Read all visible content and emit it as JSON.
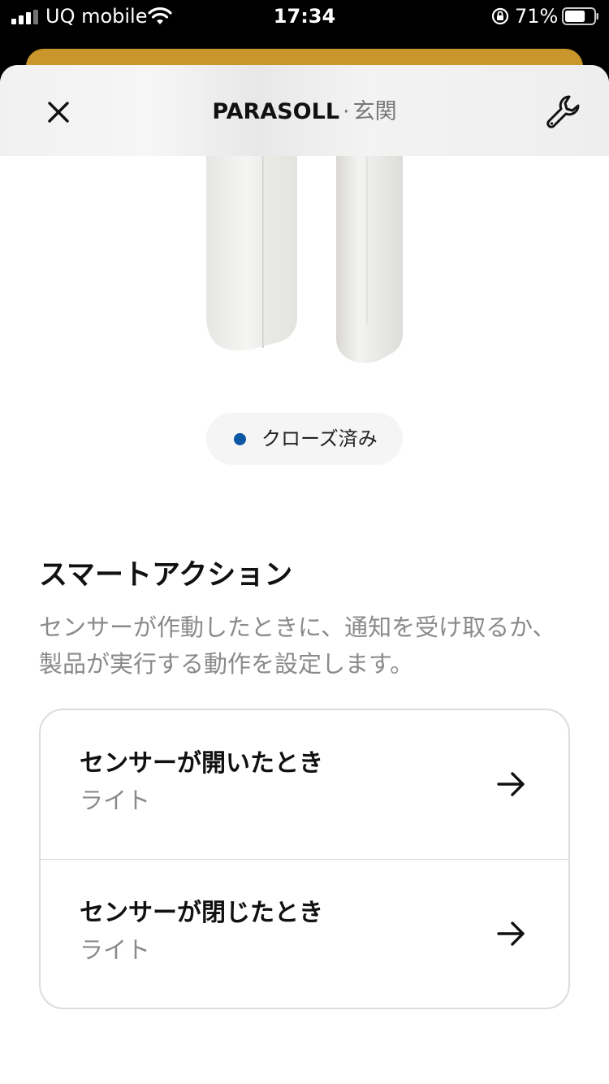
{
  "status_bar": {
    "carrier": "UQ mobile",
    "time": "17:34",
    "battery_percent": "71%",
    "battery_level": 0.71,
    "icons": [
      "signal-icon",
      "wifi-icon",
      "orientation-lock-icon",
      "battery-icon"
    ]
  },
  "header": {
    "product_name": "PARASOLL",
    "separator": "·",
    "room": "玄関",
    "close_icon": "close-icon",
    "settings_icon": "wrench-icon"
  },
  "status": {
    "label": "クローズ済み",
    "dot_color": "#0a57a3"
  },
  "smart_actions": {
    "title": "スマートアクション",
    "description": "センサーが作動したときに、通知を受け取るか、製品が実行する動作を設定します。",
    "items": [
      {
        "title": "センサーが開いたとき",
        "subtitle": "ライト",
        "icon": "arrow-right-icon"
      },
      {
        "title": "センサーが閉じたとき",
        "subtitle": "ライト",
        "icon": "arrow-right-icon"
      }
    ]
  },
  "colors": {
    "accent_gold": "#c8962a",
    "status_blue": "#0a57a3"
  }
}
